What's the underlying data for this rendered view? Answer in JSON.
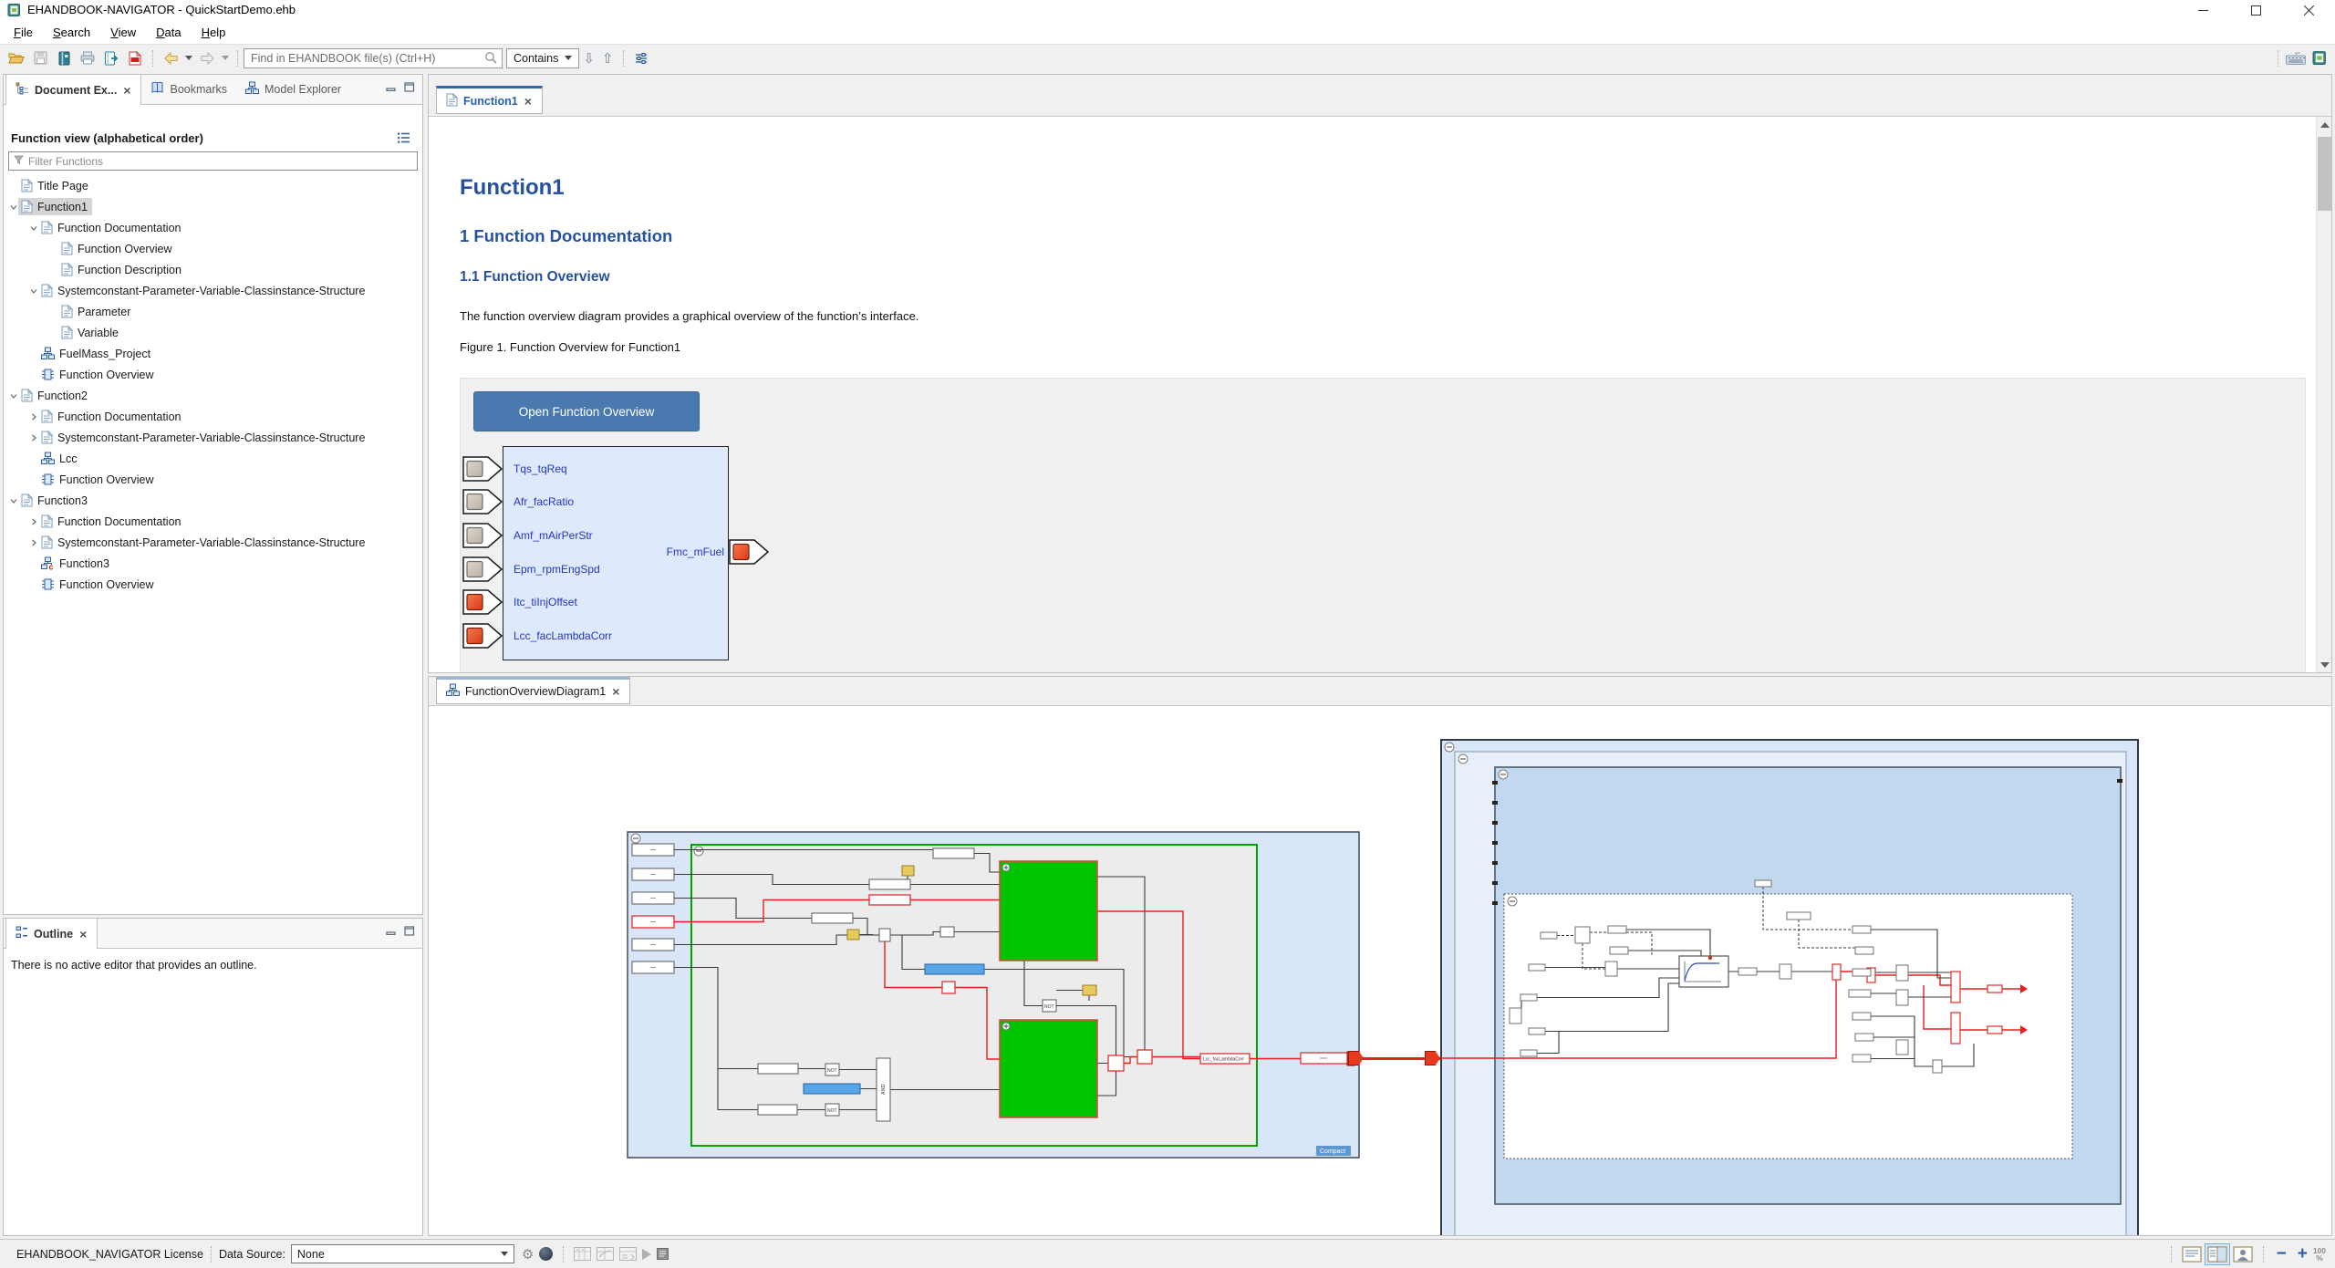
{
  "window": {
    "title": "EHANDBOOK-NAVIGATOR - QuickStartDemo.ehb"
  },
  "menubar": {
    "items": [
      "File",
      "Search",
      "View",
      "Data",
      "Help"
    ]
  },
  "toolbar": {
    "find_placeholder": "Find in EHANDBOOK file(s) (Ctrl+H)",
    "match_button": "Contains"
  },
  "explorer": {
    "tabs": [
      {
        "label": "Document Ex...",
        "icon": "document-tree-icon",
        "active": true,
        "closable": true
      },
      {
        "label": "Bookmarks",
        "icon": "bookmarks-icon",
        "active": false,
        "closable": false
      },
      {
        "label": "Model Explorer",
        "icon": "model-icon",
        "active": false,
        "closable": false
      }
    ],
    "header": "Function view (alphabetical order)",
    "filter_placeholder": "Filter Functions",
    "tree": [
      {
        "label": "Title Page",
        "level": 1,
        "expander": "",
        "icon": "document-icon",
        "selected": false
      },
      {
        "label": "Function1",
        "level": 1,
        "expander": "open",
        "icon": "document-icon",
        "selected": true
      },
      {
        "label": "Function Documentation",
        "level": 2,
        "expander": "open",
        "icon": "document-icon",
        "selected": false
      },
      {
        "label": "Function Overview",
        "level": 3,
        "expander": "",
        "icon": "document-icon",
        "selected": false
      },
      {
        "label": "Function Description",
        "level": 3,
        "expander": "",
        "icon": "document-icon",
        "selected": false
      },
      {
        "label": "Systemconstant-Parameter-Variable-Classinstance-Structure",
        "level": 2,
        "expander": "open",
        "icon": "document-icon",
        "selected": false
      },
      {
        "label": "Parameter",
        "level": 3,
        "expander": "",
        "icon": "document-icon",
        "selected": false
      },
      {
        "label": "Variable",
        "level": 3,
        "expander": "",
        "icon": "document-icon",
        "selected": false
      },
      {
        "label": "FuelMass_Project",
        "level": 2,
        "expander": "",
        "icon": "model-icon",
        "selected": false
      },
      {
        "label": "Function Overview",
        "level": 2,
        "expander": "",
        "icon": "overview-icon",
        "selected": false
      },
      {
        "label": "Function2",
        "level": 1,
        "expander": "open",
        "icon": "document-icon",
        "selected": false
      },
      {
        "label": "Function Documentation",
        "level": 2,
        "expander": "closed",
        "icon": "document-icon",
        "selected": false
      },
      {
        "label": "Systemconstant-Parameter-Variable-Classinstance-Structure",
        "level": 2,
        "expander": "closed",
        "icon": "document-icon",
        "selected": false
      },
      {
        "label": "Lcc",
        "level": 2,
        "expander": "",
        "icon": "model-icon",
        "selected": false
      },
      {
        "label": "Function Overview",
        "level": 2,
        "expander": "",
        "icon": "overview-icon",
        "selected": false
      },
      {
        "label": "Function3",
        "level": 1,
        "expander": "open",
        "icon": "document-icon",
        "selected": false
      },
      {
        "label": "Function Documentation",
        "level": 2,
        "expander": "closed",
        "icon": "document-icon",
        "selected": false
      },
      {
        "label": "Systemconstant-Parameter-Variable-Classinstance-Structure",
        "level": 2,
        "expander": "closed",
        "icon": "document-icon",
        "selected": false
      },
      {
        "label": "Function3",
        "level": 2,
        "expander": "",
        "icon": "model-c-icon",
        "selected": false
      },
      {
        "label": "Function Overview",
        "level": 2,
        "expander": "",
        "icon": "overview-icon",
        "selected": false
      }
    ]
  },
  "outline": {
    "tab": "Outline",
    "message": "There is no active editor that provides an outline."
  },
  "doc_editor": {
    "tab": "Function1",
    "title": "Function1",
    "section": "1 Function Documentation",
    "subsection": "1.1 Function Overview",
    "paragraph": "The function overview diagram provides a graphical overview of the function’s interface.",
    "caption": "Figure 1. Function Overview for Function1",
    "open_button": "Open Function Overview",
    "block": {
      "inputs": [
        {
          "label": "Tqs_tqReq",
          "port": "gray"
        },
        {
          "label": "Afr_facRatio",
          "port": "gray"
        },
        {
          "label": "Amf_mAirPerStr",
          "port": "gray"
        },
        {
          "label": "Epm_rpmEngSpd",
          "port": "gray"
        },
        {
          "label": "Itc_tiInjOffset",
          "port": "red"
        },
        {
          "label": "Lcc_facLambdaCorr",
          "port": "red"
        }
      ],
      "output": {
        "label": "Fmc_mFuel",
        "port": "red"
      }
    }
  },
  "diagram_editor": {
    "tab": "FunctionOverviewDiagram1",
    "labels": {
      "compact": "Compact",
      "not": "NOT",
      "and": "AND",
      "signal": "Lcc_facLambdaCorr"
    }
  },
  "statusbar": {
    "license": "EHANDBOOK_NAVIGATOR License",
    "data_source_label": "Data Source:",
    "data_source_value": "None",
    "zoom_value": "100",
    "zoom_unit": "%"
  },
  "colors": {
    "accent": "#3665a8",
    "heading": "#26519e",
    "button": "#4a79b0",
    "green_block": "#00c400",
    "wire_red": "#e81e1e",
    "container_blue": "#d9e6f8"
  }
}
